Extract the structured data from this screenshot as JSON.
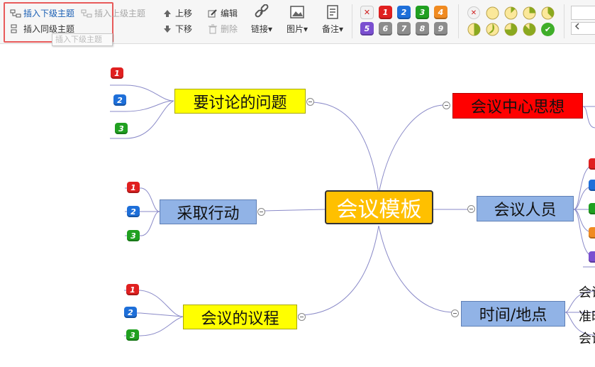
{
  "toolbar": {
    "insert_child": "插入下级主题",
    "insert_parent": "插入上级主题",
    "insert_sibling": "插入同级主题",
    "tooltip": "插入下级主题",
    "move_up": "上移",
    "move_down": "下移",
    "edit": "编辑",
    "delete": "删除",
    "link": "链接",
    "image": "图片",
    "note": "备注",
    "dropdown_arrow": "▾"
  },
  "priority_icons": {
    "remove": "✕",
    "labels": [
      "1",
      "2",
      "3",
      "4",
      "5",
      "6",
      "7",
      "8",
      "9"
    ],
    "colors": [
      "#e02020",
      "#1e6fd9",
      "#20a020",
      "#f08a20",
      "#7a4fd0",
      "#8c8c8c",
      "#8c8c8c",
      "#8c8c8c",
      "#8c8c8c"
    ]
  },
  "progress_icons": {
    "remove": "✕",
    "done": "✔",
    "levels": [
      0,
      0.125,
      0.25,
      0.375,
      0.5,
      0.625,
      0.75,
      0.875
    ]
  },
  "mindmap": {
    "root": "会议模板",
    "topics": {
      "discussion": "要讨论的问题",
      "actions": "采取行动",
      "agenda": "会议的议程",
      "central": "会议中心思想",
      "people": "会议人员",
      "time_place": "时间/地点"
    },
    "badges": [
      "1",
      "2",
      "3"
    ],
    "partial_leaves": [
      "会议",
      "准时",
      "会议"
    ]
  },
  "colors": {
    "highlight": "#e85a5a",
    "line": "#8a8ac8",
    "root_fill": "#ffc000",
    "yellow": "#ffff00",
    "blue": "#91b3e6",
    "red": "#ff0000"
  }
}
